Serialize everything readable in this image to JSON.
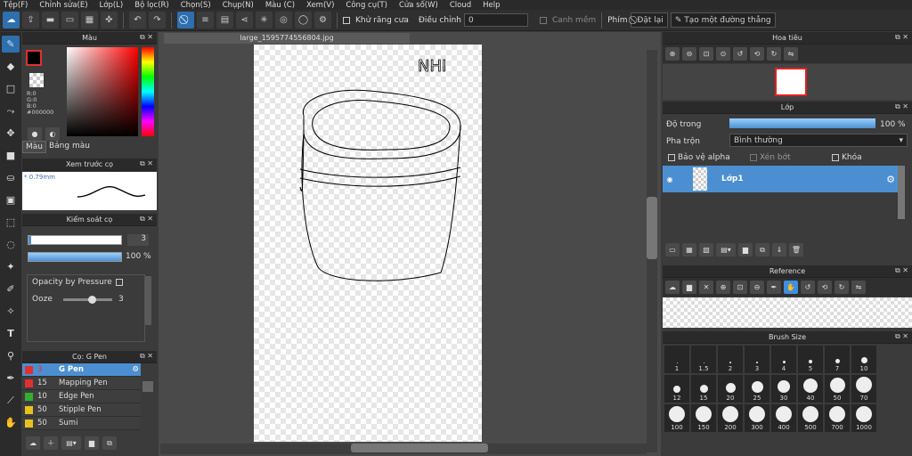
{
  "menu": [
    "Tệp(F)",
    "Chỉnh sửa(E)",
    "Lớp(L)",
    "Bộ lọc(R)",
    "Chọn(S)",
    "Chụp(N)",
    "Màu (C)",
    "Xem(V)",
    "Công cụ(T)",
    "Cửa số(W)",
    "Cloud",
    "Help"
  ],
  "toolbar": {
    "antialias_label": "Khử răng cưa",
    "adjust_label": "Điều chỉnh",
    "adjust_value": "0",
    "smooth_label": "Canh mềm",
    "keys_label": "Phím",
    "reset_label": "Đặt lại",
    "straight_line_label": "Tạo một đường thẳng"
  },
  "color_panel": {
    "title": "Màu",
    "r": "R:0",
    "g": "G:0",
    "b": "B:0",
    "hex": "#000000",
    "tab1": "Màu",
    "tab2": "Bảng màu",
    "color_main": "#000000",
    "color_bg": "#ffffff"
  },
  "preview_panel": {
    "title": "Xem trước cọ",
    "size": "0.79mm"
  },
  "brush_control": {
    "title": "Kiểm soát cọ",
    "size_value": "3",
    "opacity_value": "100 %",
    "opacity_pressure": "Opacity by Pressure",
    "ooze_label": "Ooze",
    "ooze_value": "3"
  },
  "brush_list": {
    "title": "Cọ: G Pen",
    "items": [
      {
        "size": "3",
        "name": "G Pen",
        "color": "#e03030"
      },
      {
        "size": "15",
        "name": "Mapping Pen",
        "color": "#e03030"
      },
      {
        "size": "10",
        "name": "Edge Pen",
        "color": "#30b030"
      },
      {
        "size": "50",
        "name": "Stipple Pen",
        "color": "#e8c020"
      },
      {
        "size": "50",
        "name": "Sumi",
        "color": "#e8c020"
      }
    ]
  },
  "document": {
    "tab_title": "large_1595774556804.jpg",
    "sketch_text": "NHI"
  },
  "navigator": {
    "title": "Hoa tiêu"
  },
  "layer_panel": {
    "title": "Lớp",
    "opacity_label": "Độ trong",
    "opacity_value": "100 %",
    "blend_label": "Pha trộn",
    "blend_value": "Bình thường",
    "protect_alpha": "Bảo vệ alpha",
    "clipping": "Xén bớt",
    "lock": "Khóa",
    "layer_name": "Lớp1"
  },
  "reference_panel": {
    "title": "Reference"
  },
  "brush_size_panel": {
    "title": "Brush Size",
    "sizes": [
      "1",
      "1.5",
      "2",
      "3",
      "4",
      "5",
      "7",
      "10",
      "12",
      "15",
      "20",
      "25",
      "30",
      "40",
      "50",
      "70",
      "100",
      "150",
      "200",
      "300",
      "400",
      "500",
      "700",
      "1000"
    ]
  }
}
